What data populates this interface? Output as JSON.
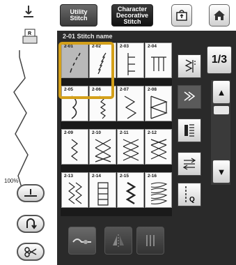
{
  "header": {
    "tab_utility_label": "Utility Stitch",
    "tab_character_label": "Character Decorative Stitch",
    "icon_memory": "memory-pocket-icon",
    "icon_home": "home-icon"
  },
  "left": {
    "zoom_label": "100%"
  },
  "panel": {
    "title": "2-01  Stitch name"
  },
  "grid": {
    "cells": [
      {
        "code": "2-01"
      },
      {
        "code": "2-02"
      },
      {
        "code": "2-03"
      },
      {
        "code": "2-04"
      },
      {
        "code": "2-05"
      },
      {
        "code": "2-06"
      },
      {
        "code": "2-07"
      },
      {
        "code": "2-08"
      },
      {
        "code": "2-09"
      },
      {
        "code": "2-10"
      },
      {
        "code": "2-11"
      },
      {
        "code": "2-12"
      },
      {
        "code": "2-13"
      },
      {
        "code": "2-14"
      },
      {
        "code": "2-15"
      },
      {
        "code": "2-16"
      }
    ],
    "selected_code": "2-01"
  },
  "pager": {
    "page_label": "1/3"
  },
  "colors": {
    "highlight": "#d4a01a",
    "panel": "#2a2a2a"
  }
}
